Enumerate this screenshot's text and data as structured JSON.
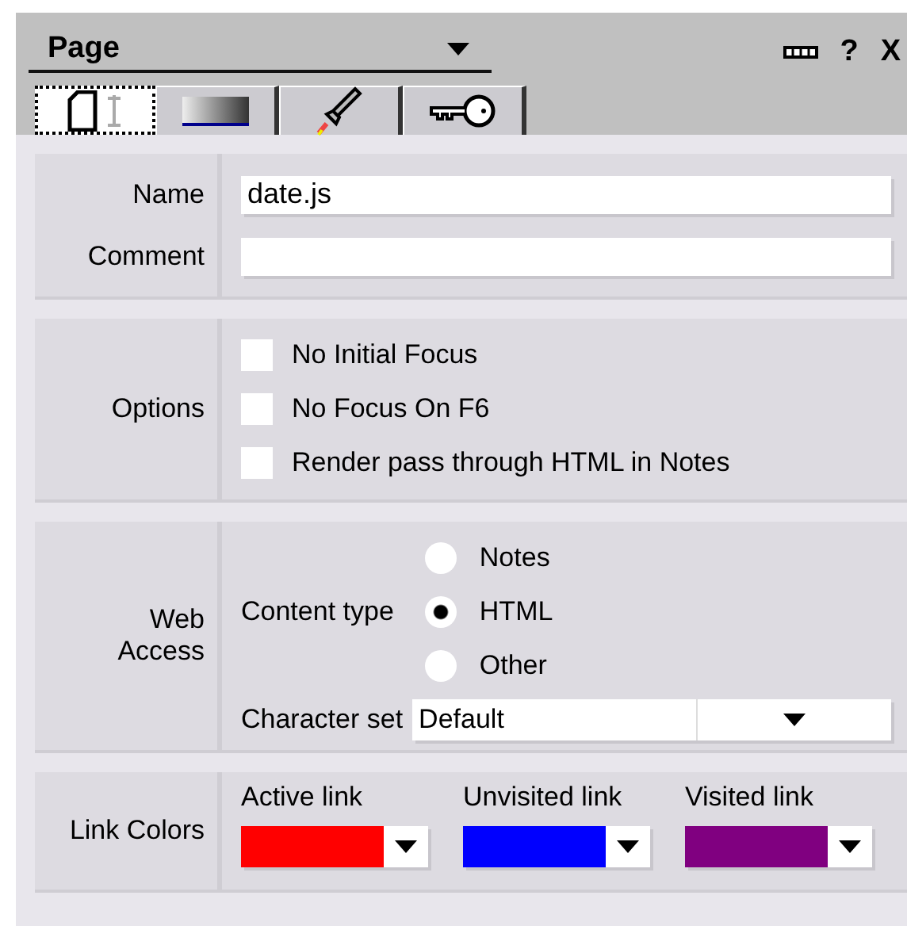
{
  "panel": {
    "title": "Page",
    "tabs": [
      {
        "selected": true
      },
      {
        "selected": false
      },
      {
        "selected": false
      },
      {
        "selected": false
      }
    ],
    "header_buttons": [
      "?",
      "X"
    ]
  },
  "basics": {
    "fields": [
      {
        "label": "Name",
        "value": "date.js"
      },
      {
        "label": "Comment"
      }
    ]
  },
  "options": {
    "label": "Options",
    "checkboxes": [
      {
        "label": "No Initial Focus",
        "checked": false
      },
      {
        "label": "No Focus On F6",
        "checked": false
      },
      {
        "label": "Render pass through HTML in Notes",
        "checked": false
      }
    ]
  },
  "web_access": {
    "label": "Web Access",
    "content_type": {
      "label": "Content type",
      "options": [
        {
          "label": "Notes",
          "selected": false
        },
        {
          "label": "HTML",
          "selected": true
        },
        {
          "label": "Other",
          "selected": false
        }
      ]
    },
    "character_set": {
      "label": "Character set",
      "value": "Default"
    }
  },
  "link_colors": {
    "label": "Link Colors",
    "pickers": [
      {
        "label": "Active link",
        "color": "#ff0000"
      },
      {
        "label": "Unvisited link",
        "color": "#0000ff"
      },
      {
        "label": "Visited link",
        "color": "#800080"
      }
    ]
  }
}
